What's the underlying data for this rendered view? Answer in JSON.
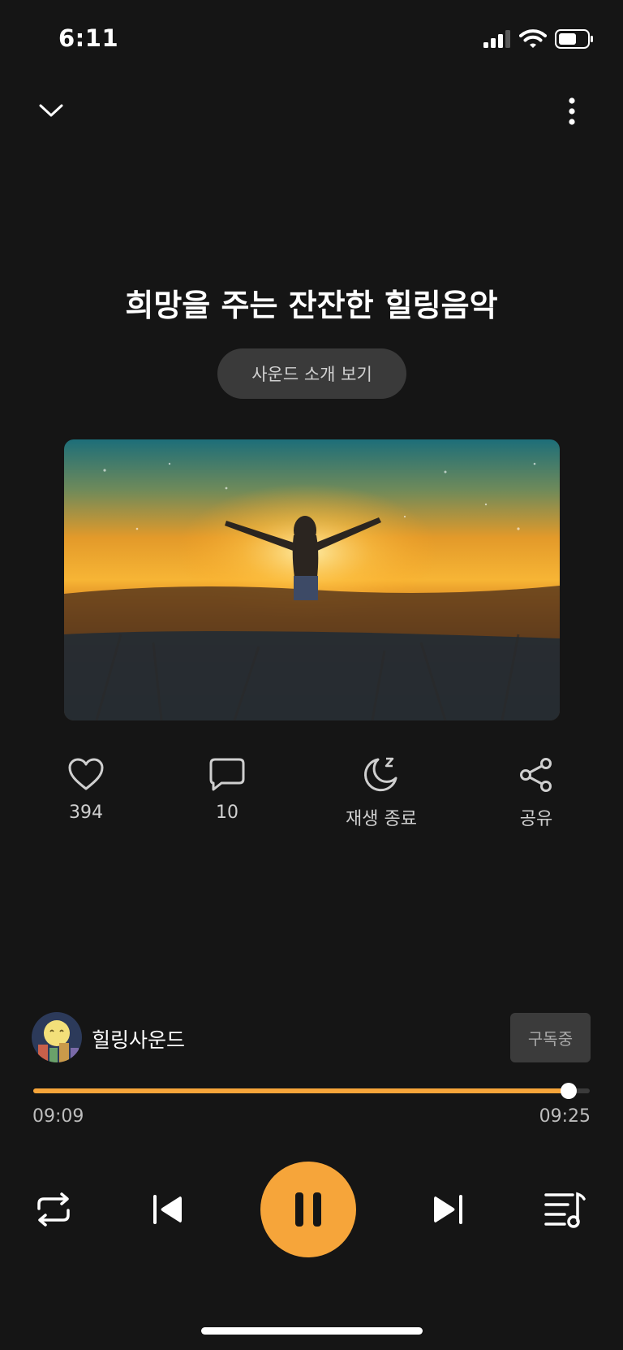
{
  "status_bar": {
    "time": "6:11"
  },
  "title": "희망을 주는 잔잔한 힐링음악",
  "intro_button": "사운드 소개 보기",
  "actions": {
    "like_count": "394",
    "comment_count": "10",
    "sleep_timer_label": "재생 종료",
    "share_label": "공유"
  },
  "channel": {
    "name": "힐링사운드",
    "subscribe_label": "구독중"
  },
  "player": {
    "current_time": "09:09",
    "total_time": "09:25",
    "progress": 0.9628
  },
  "colors": {
    "accent": "#f6a53a",
    "background": "#151515"
  },
  "icons": {
    "top_left": "chevron-down-icon",
    "top_right": "more-vertical-icon",
    "like": "heart-icon",
    "comment": "comment-icon",
    "sleep": "moon-zzz-icon",
    "share": "share-icon",
    "repeat": "repeat-icon",
    "prev": "skip-previous-icon",
    "play_pause": "pause-icon",
    "next": "skip-next-icon",
    "playlist": "playlist-icon"
  }
}
